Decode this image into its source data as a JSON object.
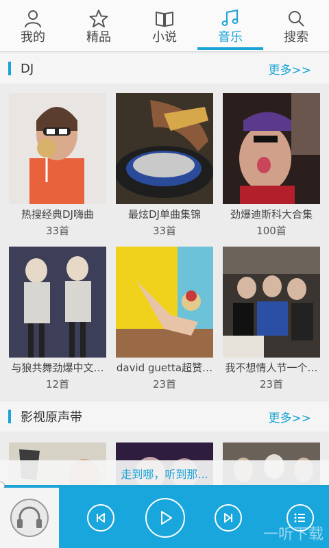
{
  "nav": {
    "tabs": [
      {
        "label": "我的",
        "icon": "person-icon",
        "active": false
      },
      {
        "label": "精品",
        "icon": "star-icon",
        "active": false
      },
      {
        "label": "小说",
        "icon": "book-icon",
        "active": false
      },
      {
        "label": "音乐",
        "icon": "music-note-icon",
        "active": true
      },
      {
        "label": "搜索",
        "icon": "search-icon",
        "active": false
      }
    ]
  },
  "sections": [
    {
      "title": "DJ",
      "more": "更多>>",
      "items": [
        {
          "title": "热搜经典DJ嗨曲",
          "count": "33首"
        },
        {
          "title": "最炫DJ单曲集锦",
          "count": "33首"
        },
        {
          "title": "劲爆迪斯科大合集",
          "count": "100首"
        },
        {
          "title": "与狼共舞劲爆中文…",
          "count": "12首"
        },
        {
          "title": "david guetta超赞…",
          "count": "23首"
        },
        {
          "title": "我不想情人节一个…",
          "count": "23首"
        }
      ]
    },
    {
      "title": "影视原声带",
      "more": "更多>>"
    }
  ],
  "player": {
    "now_playing": "走到哪，听到那...",
    "watermark": "一听下载",
    "accent": "#1aa3d6",
    "controls": [
      "headphones-icon",
      "previous-icon",
      "play-icon",
      "next-icon",
      "playlist-icon"
    ]
  }
}
